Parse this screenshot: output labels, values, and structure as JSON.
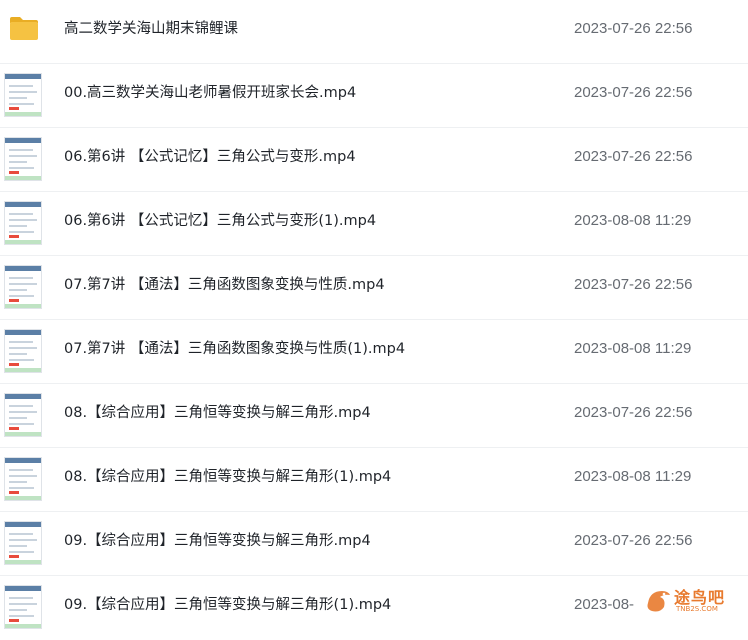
{
  "files": [
    {
      "name": "高二数学关海山期末锦鲤课",
      "date": "2023-07-26 22:56",
      "kind": "folder"
    },
    {
      "name": "00.高三数学关海山老师暑假开班家长会.mp4",
      "date": "2023-07-26 22:56",
      "kind": "video"
    },
    {
      "name": "06.第6讲 【公式记忆】三角公式与变形.mp4",
      "date": "2023-07-26 22:56",
      "kind": "video"
    },
    {
      "name": "06.第6讲 【公式记忆】三角公式与变形(1).mp4",
      "date": "2023-08-08 11:29",
      "kind": "video"
    },
    {
      "name": "07.第7讲 【通法】三角函数图象变换与性质.mp4",
      "date": "2023-07-26 22:56",
      "kind": "video"
    },
    {
      "name": "07.第7讲 【通法】三角函数图象变换与性质(1).mp4",
      "date": "2023-08-08 11:29",
      "kind": "video"
    },
    {
      "name": "08.【综合应用】三角恒等变换与解三角形.mp4",
      "date": "2023-07-26 22:56",
      "kind": "video"
    },
    {
      "name": "08.【综合应用】三角恒等变换与解三角形(1).mp4",
      "date": "2023-08-08 11:29",
      "kind": "video"
    },
    {
      "name": "09.【综合应用】三角恒等变换与解三角形.mp4",
      "date": "2023-07-26 22:56",
      "kind": "video"
    },
    {
      "name": "09.【综合应用】三角恒等变换与解三角形(1).mp4",
      "date": "2023-08-",
      "kind": "video"
    }
  ],
  "watermark": {
    "text": "途鸟吧",
    "subtext": "TNB2S.COM"
  },
  "colors": {
    "folder": "#f5c242",
    "folder_tab": "#e9ad24",
    "watermark": "#e87a2e"
  },
  "icons": {
    "folder": "folder-icon",
    "video": "video-thumbnail-icon"
  }
}
